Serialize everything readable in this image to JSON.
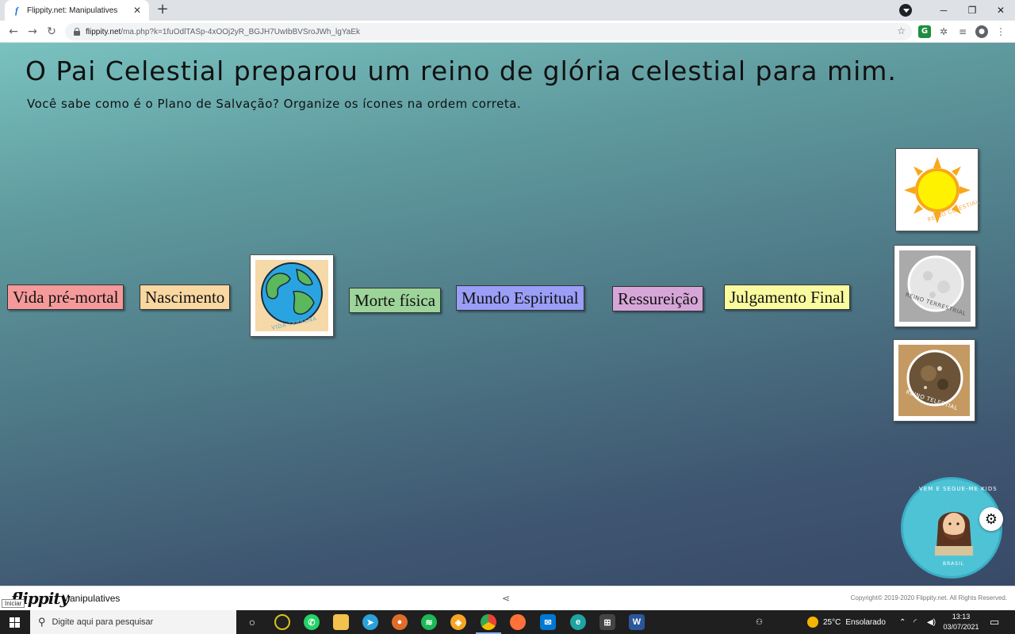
{
  "browser": {
    "tab_title": "Flippity.net: Manipulatives",
    "tab_favicon": "f",
    "new_tab": "+",
    "url_host": "flippity.net",
    "url_path": "/ma.php?k=1fuOdlTASp-4xOOj2yR_BGJH7UwIbBVSroJWh_lgYaEk",
    "window_controls": {
      "minimize": "─",
      "maximize": "❐",
      "close": "✕"
    }
  },
  "page": {
    "title": "O Pai Celestial preparou um reino de glória celestial para mim.",
    "subtitle": "Você sabe como é o Plano de Salvação? Organize os ícones na ordem correta.",
    "label_cards": [
      {
        "text": "Vida pré-mortal",
        "color": "#f59a9a"
      },
      {
        "text": "Nascimento",
        "color": "#f9d7a0"
      },
      {
        "text": "Morte física",
        "color": "#9dd49a"
      },
      {
        "text": "Mundo Espiritual",
        "color": "#9a9ef7"
      },
      {
        "text": "Ressureição",
        "color": "#d6a6d8"
      },
      {
        "text": "Julgamento Final",
        "color": "#fafa9e"
      }
    ],
    "image_cards": [
      {
        "name": "earth",
        "caption": "VIDA TERRENA"
      },
      {
        "name": "sun",
        "caption": "REINO CELESTIAL"
      },
      {
        "name": "moon",
        "caption": "REINO TERRESTRIAL"
      },
      {
        "name": "star",
        "caption": "REINO TELESTIAL"
      }
    ],
    "logo": {
      "ring_text": "VEM E SEGUE-ME KIDS",
      "bottom_text": "BRASIL"
    },
    "settings_icon": "gear-icon"
  },
  "footer": {
    "brand": "flippity",
    "app_name": "Manipulatives",
    "copyright": "Copyright© 2019-2020 Flippity.net. All Rights Reserved.",
    "tooltip": "Iniciar"
  },
  "taskbar": {
    "search_placeholder": "Digite aqui para pesquisar",
    "weather_temp": "25°C",
    "weather_text": "Ensolarado",
    "time": "13:13",
    "date": "03/07/2021"
  }
}
